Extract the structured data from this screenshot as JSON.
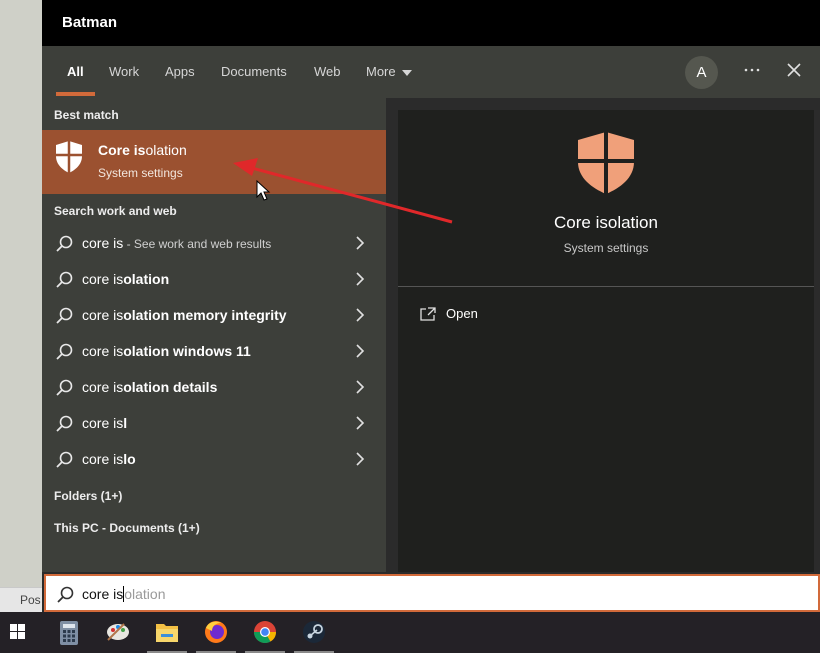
{
  "window": {
    "title": "Batman"
  },
  "tabs": [
    {
      "label": "All",
      "active": true
    },
    {
      "label": "Work"
    },
    {
      "label": "Apps"
    },
    {
      "label": "Documents"
    },
    {
      "label": "Web"
    },
    {
      "label": "More"
    }
  ],
  "header": {
    "avatar_initial": "A",
    "more_options_icon": "ellipsis-icon",
    "close_icon": "close-icon"
  },
  "sections": {
    "best_match": "Best match",
    "search_web": "Search work and web",
    "folders": "Folders (1+)",
    "this_pc": "This PC - Documents (1+)"
  },
  "best_match": {
    "title_pre": "Core is",
    "title_suf": "olation",
    "subtitle": "System settings",
    "icon": "shield-icon"
  },
  "suggestions": [
    {
      "pre": "core is",
      "suf": "",
      "hint": " - See work and web results"
    },
    {
      "pre": "core is",
      "suf": "olation",
      "hint": ""
    },
    {
      "pre": "core is",
      "suf": "olation memory integrity",
      "hint": ""
    },
    {
      "pre": "core is",
      "suf": "olation windows 11",
      "hint": ""
    },
    {
      "pre": "core is",
      "suf": "olation details",
      "hint": ""
    },
    {
      "pre": "core is",
      "suf": "l",
      "hint": ""
    },
    {
      "pre": "core is",
      "suf": "lo",
      "hint": ""
    }
  ],
  "preview": {
    "title": "Core isolation",
    "subtitle": "System settings",
    "action_open": "Open"
  },
  "search": {
    "typed": "core is",
    "ghost": "olation"
  },
  "desktop": {
    "partial_text": "Pos"
  },
  "taskbar": [
    "windows-start-icon",
    "calculator-icon",
    "paint-icon",
    "file-explorer-icon",
    "firefox-icon",
    "chrome-icon",
    "steam-icon"
  ],
  "colors": {
    "accent": "#d26a3a",
    "selected": "#9b5130",
    "shield": "#f0a07a"
  }
}
